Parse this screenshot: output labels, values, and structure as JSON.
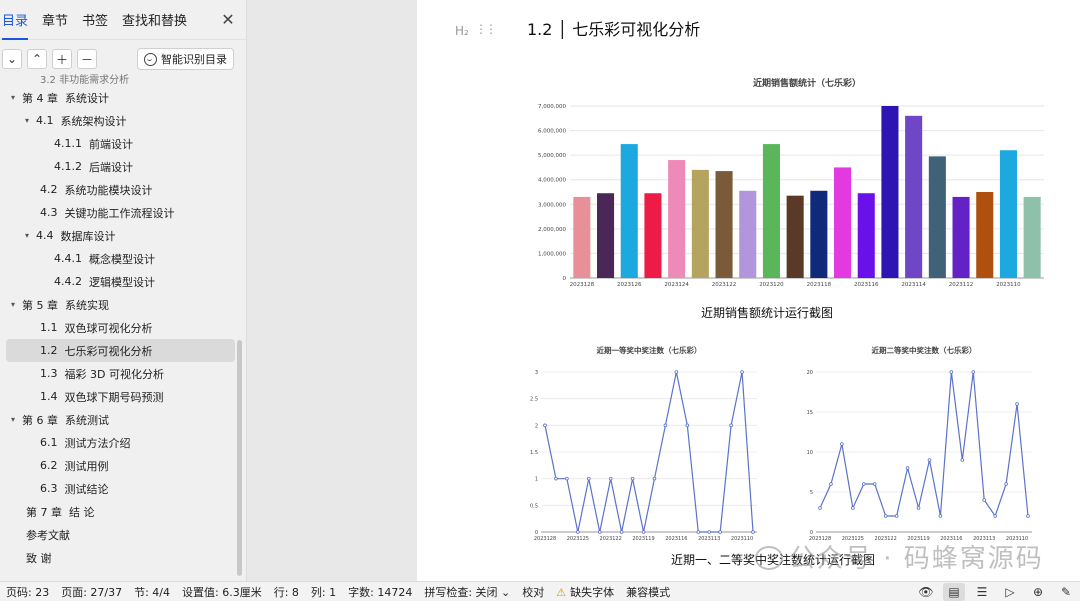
{
  "sidebar": {
    "tabs": [
      "目录",
      "章节",
      "书签",
      "查找和替换"
    ],
    "smart_button": "智能识别目录",
    "partial_item": "3.2  非功能需求分析",
    "toc": [
      {
        "caret": "▾",
        "indent": 14,
        "num": "第 4 章",
        "label": "系统设计"
      },
      {
        "caret": "▾",
        "indent": 28,
        "num": "4.1",
        "label": "系统架构设计"
      },
      {
        "caret": "",
        "indent": 54,
        "num": "4.1.1",
        "label": "前端设计"
      },
      {
        "caret": "",
        "indent": 54,
        "num": "4.1.2",
        "label": "后端设计"
      },
      {
        "caret": "",
        "indent": 40,
        "num": "4.2",
        "label": "系统功能模块设计"
      },
      {
        "caret": "",
        "indent": 40,
        "num": "4.3",
        "label": "关键功能工作流程设计"
      },
      {
        "caret": "▾",
        "indent": 28,
        "num": "4.4",
        "label": "数据库设计"
      },
      {
        "caret": "",
        "indent": 54,
        "num": "4.4.1",
        "label": "概念模型设计"
      },
      {
        "caret": "",
        "indent": 54,
        "num": "4.4.2",
        "label": "逻辑模型设计"
      },
      {
        "caret": "▾",
        "indent": 14,
        "num": "第 5 章",
        "label": "系统实现"
      },
      {
        "caret": "",
        "indent": 40,
        "num": "1.1",
        "label": "双色球可视化分析"
      },
      {
        "caret": "",
        "indent": 40,
        "num": "1.2",
        "label": "七乐彩可视化分析",
        "selected": true
      },
      {
        "caret": "",
        "indent": 40,
        "num": "1.3",
        "label": "福彩 3D 可视化分析"
      },
      {
        "caret": "",
        "indent": 40,
        "num": "1.4",
        "label": "双色球下期号码预测"
      },
      {
        "caret": "▾",
        "indent": 14,
        "num": "第 6 章",
        "label": "系统测试"
      },
      {
        "caret": "",
        "indent": 40,
        "num": "6.1",
        "label": "测试方法介绍"
      },
      {
        "caret": "",
        "indent": 40,
        "num": "6.2",
        "label": "测试用例"
      },
      {
        "caret": "",
        "indent": 40,
        "num": "6.3",
        "label": "测试结论"
      },
      {
        "caret": "",
        "indent": 26,
        "num": "第 7 章",
        "label": "结    论"
      },
      {
        "caret": "",
        "indent": 26,
        "num": "",
        "label": "参考文献"
      },
      {
        "caret": "",
        "indent": 26,
        "num": "",
        "label": "致    谢"
      }
    ]
  },
  "doc": {
    "heading_tag": "H₂",
    "heading": "1.2 │ 七乐彩可视化分析",
    "caption1": "近期销售额统计运行截图",
    "caption2": "近期一、二等奖中奖注数统计运行截图",
    "watermark": "公众号 · 码蜂窝源码"
  },
  "chart_data": [
    {
      "type": "bar",
      "title": "近期销售额统计（七乐彩）",
      "x_tick_labels": [
        "2023128",
        "2023126",
        "2023124",
        "2023122",
        "2023120",
        "2023118",
        "2023116",
        "2023114",
        "2023112",
        "2023110"
      ],
      "values": [
        3300000,
        3450000,
        5450000,
        3450000,
        4800000,
        4400000,
        4350000,
        3550000,
        5450000,
        3350000,
        3550000,
        4500000,
        3450000,
        7000000,
        6600000,
        4950000,
        3300000,
        3500000,
        5200000,
        3300000
      ],
      "colors": [
        "#e8909a",
        "#4a2756",
        "#1ea8e0",
        "#ed1c47",
        "#ed8ab8",
        "#b4a460",
        "#7a5a38",
        "#b196dc",
        "#5bb55b",
        "#5a3a26",
        "#0f2a78",
        "#e23ae0",
        "#6a10e8",
        "#2f14b4",
        "#6f46c6",
        "#3f6278",
        "#6422c6",
        "#b0500e",
        "#1ea8e0",
        "#8fc0a9"
      ],
      "y_ticks": [
        "0",
        "1,000,000",
        "2,000,000",
        "3,000,000",
        "4,000,000",
        "5,000,000",
        "6,000,000",
        "7,000,000"
      ],
      "ylim": [
        0,
        7000000
      ]
    },
    {
      "type": "line",
      "title": "近期一等奖中奖注数（七乐彩）",
      "x_tick_labels": [
        "2023128",
        "2023125",
        "2023122",
        "2023119",
        "2023116",
        "2023113",
        "2023110"
      ],
      "values": [
        2,
        1,
        1,
        0,
        1,
        0,
        1,
        0,
        1,
        0,
        1,
        2,
        3,
        2,
        0,
        0,
        0,
        2,
        3,
        0
      ],
      "y_ticks": [
        "0",
        "0.5",
        "1",
        "1.5",
        "2",
        "2.5",
        "3"
      ],
      "ylim": [
        0,
        3
      ],
      "color": "#5b73c9"
    },
    {
      "type": "line",
      "title": "近期二等奖中奖注数（七乐彩）",
      "x_tick_labels": [
        "2023128",
        "2023125",
        "2023122",
        "2023119",
        "2023116",
        "2023113",
        "2023110"
      ],
      "values": [
        3,
        6,
        11,
        3,
        6,
        6,
        2,
        2,
        8,
        3,
        9,
        2,
        20,
        9,
        20,
        4,
        2,
        6,
        16,
        2
      ],
      "y_ticks": [
        "0",
        "5",
        "10",
        "15",
        "20"
      ],
      "ylim": [
        0,
        20
      ],
      "color": "#5b73c9"
    }
  ],
  "status": {
    "page_no": "页码: 23",
    "pages": "页面: 27/37",
    "section": "节: 4/4",
    "setting": "设置值: 6.3厘米",
    "row": "行: 8",
    "col": "列: 1",
    "words": "字数: 14724",
    "spell": "拼写检查: 关闭",
    "proof": "校对",
    "font_missing": "缺失字体",
    "compat": "兼容模式"
  }
}
